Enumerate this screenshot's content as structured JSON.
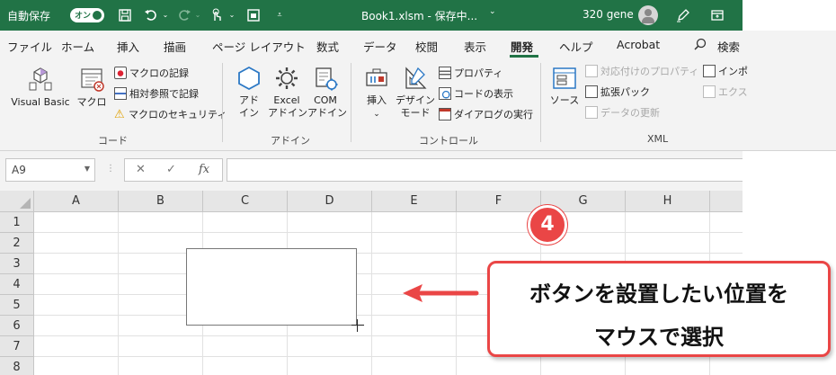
{
  "titlebar": {
    "autosave_label": "自動保存",
    "autosave_state": "オン",
    "filename": "Book1.xlsm - 保存中...",
    "filename_caret": "⌄",
    "user": "320 gene",
    "icons": [
      "save-icon",
      "undo-icon",
      "redo-icon",
      "touch-mode-icon",
      "form-icon",
      "customize-icon",
      "pen-icon",
      "ribbon-display-icon"
    ]
  },
  "tabs": [
    "ファイル",
    "ホーム",
    "挿入",
    "描画",
    "ページ レイアウト",
    "数式",
    "データ",
    "校閲",
    "表示",
    "開発",
    "ヘルプ",
    "Acrobat"
  ],
  "active_tab": "開発",
  "search_label": "検索",
  "ribbon": {
    "code": {
      "label": "コード",
      "visual_basic": "Visual Basic",
      "macro": "マクロ",
      "record_macro": "マクロの記録",
      "relative_ref": "相対参照で記録",
      "macro_security": "マクロのセキュリティ"
    },
    "addins": {
      "label": "アドイン",
      "addin_l1": "アド",
      "addin_l2": "イン",
      "excel_l1": "Excel",
      "excel_l2": "アドイン",
      "com_l1": "COM",
      "com_l2": "アドイン"
    },
    "controls": {
      "label": "コントロール",
      "insert": "挿入",
      "insert_caret": "⌄",
      "design_l1": "デザイン",
      "design_l2": "モード",
      "properties": "プロパティ",
      "view_code": "コードの表示",
      "run_dialog": "ダイアログの実行"
    },
    "xml": {
      "label": "XML",
      "source": "ソース",
      "map_properties": "対応付けのプロパティ",
      "expansion_packs": "拡張パック",
      "refresh_data": "データの更新",
      "import": "インポ",
      "export": "エクス"
    }
  },
  "formula_bar": {
    "name_box": "A9",
    "cancel": "✕",
    "enter": "✓",
    "fx": "fx",
    "value": ""
  },
  "grid": {
    "columns": [
      "A",
      "B",
      "C",
      "D",
      "E",
      "F",
      "G",
      "H"
    ],
    "rows": [
      "1",
      "2",
      "3",
      "4",
      "5",
      "6",
      "7",
      "8"
    ]
  },
  "annotation": {
    "step": "4",
    "line1": "ボタンを設置したい位置を",
    "line2": "マウスで選択",
    "color": "#ea4646"
  },
  "colors": {
    "excel_green": "#217346",
    "accent_red": "#ea4646"
  }
}
